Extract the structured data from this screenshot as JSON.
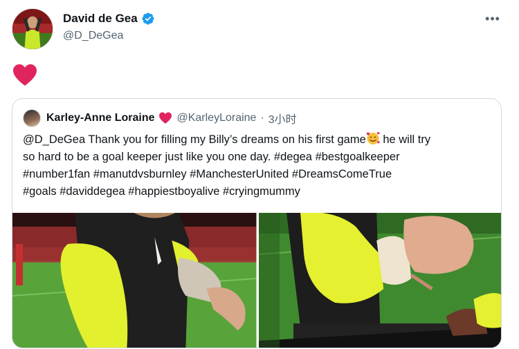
{
  "tweet": {
    "author": {
      "display_name": "David de Gea",
      "handle": "@D_DeGea",
      "verified": true,
      "avatar_icon": "profile-photo"
    },
    "body_emoji": "red-heart",
    "more_icon": "more-options-icon",
    "more_label": "•••"
  },
  "quoted_tweet": {
    "author": {
      "display_name": "Karley-Anne Loraine",
      "name_emoji": "red-heart",
      "handle": "@KarleyLoraine",
      "separator": "·",
      "time": "3小时"
    },
    "text": {
      "line1_before_emoji": "@D_DeGea Thank you for filling my Billy’s dreams on his first game",
      "line1_emoji": "smiling-face-with-hearts",
      "line1_after_emoji": " he will try",
      "line2": "so hard to be a goal keeper just like you one day. #degea #bestgoalkeeper",
      "line3": "#number1fan #manutdvsburnley  #ManchesterUnited #DreamsComeTrue",
      "line4": "#goals #daviddegea #happiestboyalive #cryingmummy"
    },
    "media": [
      {
        "kind": "photo",
        "subject": "goalkeeper-arm-reaching"
      },
      {
        "kind": "photo",
        "subject": "goalkeeper-fist-bump"
      }
    ]
  },
  "colors": {
    "text_primary": "#0f1419",
    "text_secondary": "#536471",
    "verified_blue": "#1d9bf0",
    "heart_red": "#e0245e",
    "border": "#cfd9de",
    "jersey_yellow": "#e6f23a"
  }
}
